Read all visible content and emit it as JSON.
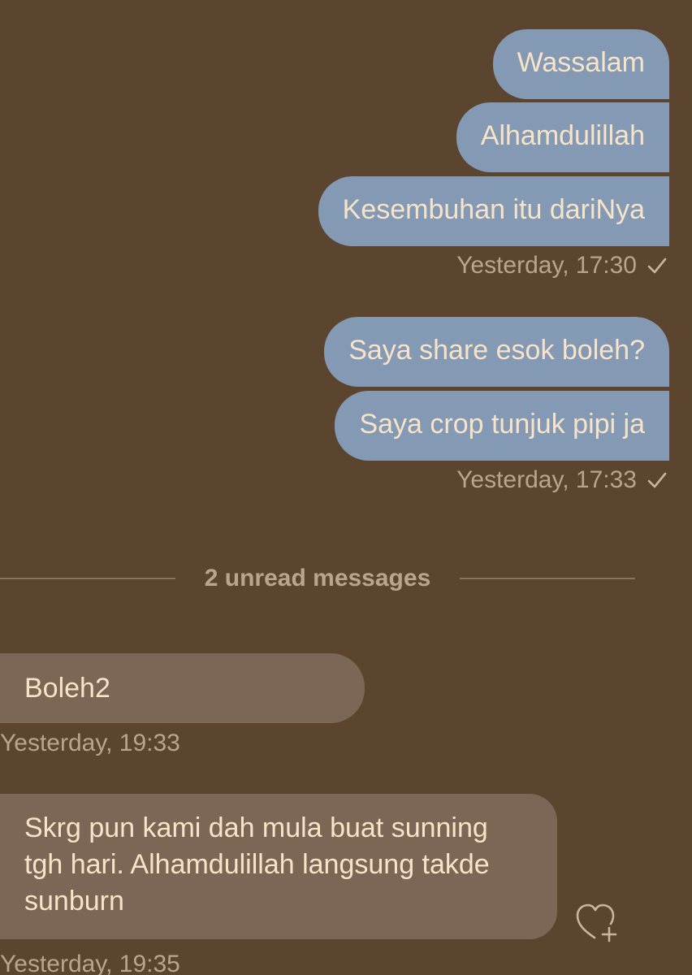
{
  "messages_out_1": [
    {
      "text": "Wassalam"
    },
    {
      "text": "Alhamdulillah"
    },
    {
      "text": "Kesembuhan itu dariNya"
    }
  ],
  "timestamp_out_1": "Yesterday, 17:30",
  "messages_out_2": [
    {
      "text": "Saya share esok boleh?"
    },
    {
      "text": "Saya crop tunjuk pipi ja"
    }
  ],
  "timestamp_out_2": "Yesterday, 17:33",
  "unread_divider": "2 unread messages",
  "messages_in": [
    {
      "text": "Boleh2",
      "timestamp": "Yesterday, 19:33"
    },
    {
      "text": "Skrg pun kami dah mula buat sunning tgh hari. Alhamdulillah langsung takde sunburn",
      "timestamp": "Yesterday, 19:35"
    }
  ],
  "icons": {
    "read_receipt": "checkmark-icon",
    "reaction": "heart-plus-icon"
  },
  "colors": {
    "background": "#5c452f",
    "outgoing_bubble": "#8499b4",
    "incoming_bubble": "#7c6756",
    "bubble_text": "#f6e3c8",
    "meta_text": "#b9a58d"
  }
}
